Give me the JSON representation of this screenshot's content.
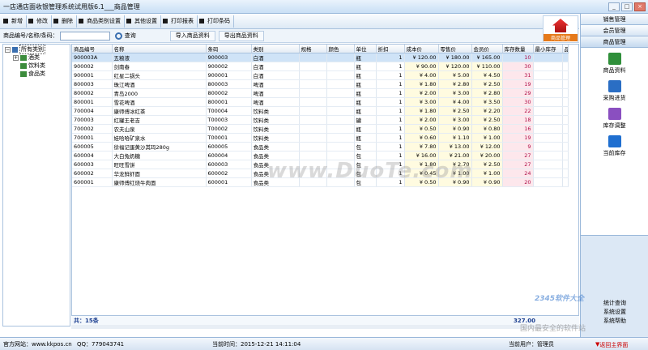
{
  "window": {
    "title": "一店通店面收银管理系统试用版6.1___商品管理",
    "min": "_",
    "max": "□",
    "close": "×"
  },
  "toolbar": {
    "items": [
      "新增",
      "修改",
      "删除",
      "商品类别设置",
      "其他设置",
      "打印报表",
      "打印条码"
    ]
  },
  "search": {
    "label": "商品编号/名称/条码：",
    "value": "",
    "query_btn": "查询",
    "import_btn": "导入商品资料",
    "export_btn": "导出商品资料"
  },
  "tree": {
    "root": "所有类别",
    "nodes": [
      "酒类",
      "饮料类",
      "食品类"
    ],
    "expand": "+"
  },
  "table": {
    "headers": [
      "商品编号",
      "名称",
      "条码",
      "类别",
      "规格",
      "颜色",
      "单位",
      "折扣",
      "成本价",
      "零售价",
      "会员价",
      "库存数量",
      "最小库存",
      "品牌"
    ],
    "rows": [
      [
        "900003A",
        "五粮液",
        "900003",
        "白酒",
        "",
        "",
        "瓶",
        "1",
        "¥ 120.00",
        "¥ 180.00",
        "¥ 165.00",
        "10",
        "",
        ""
      ],
      [
        "900002",
        "剑南春",
        "900002",
        "白酒",
        "",
        "",
        "瓶",
        "1",
        "¥ 90.00",
        "¥ 120.00",
        "¥ 110.00",
        "30",
        "",
        ""
      ],
      [
        "900001",
        "红星二锅头",
        "900001",
        "白酒",
        "",
        "",
        "瓶",
        "1",
        "¥ 4.00",
        "¥ 5.00",
        "¥ 4.50",
        "31",
        "",
        ""
      ],
      [
        "800003",
        "珠江啤酒",
        "800003",
        "啤酒",
        "",
        "",
        "瓶",
        "1",
        "¥ 1.80",
        "¥ 2.80",
        "¥ 2.50",
        "19",
        "",
        ""
      ],
      [
        "800002",
        "青岛2000",
        "800002",
        "啤酒",
        "",
        "",
        "瓶",
        "1",
        "¥ 2.00",
        "¥ 3.00",
        "¥ 2.80",
        "29",
        "",
        ""
      ],
      [
        "800001",
        "雪花啤酒",
        "800001",
        "啤酒",
        "",
        "",
        "瓶",
        "1",
        "¥ 3.00",
        "¥ 4.00",
        "¥ 3.50",
        "30",
        "",
        ""
      ],
      [
        "700004",
        "康师傅冰红茶",
        "T00004",
        "饮料类",
        "",
        "",
        "瓶",
        "1",
        "¥ 1.80",
        "¥ 2.50",
        "¥ 2.20",
        "22",
        "",
        ""
      ],
      [
        "700003",
        "红罐王老吉",
        "T00003",
        "饮料类",
        "",
        "",
        "罐",
        "1",
        "¥ 2.00",
        "¥ 3.00",
        "¥ 2.50",
        "18",
        "",
        ""
      ],
      [
        "700002",
        "农夫山泉",
        "T00002",
        "饮料类",
        "",
        "",
        "瓶",
        "1",
        "¥ 0.50",
        "¥ 0.90",
        "¥ 0.80",
        "16",
        "",
        ""
      ],
      [
        "700001",
        "娃哈哈矿泉水",
        "T00001",
        "饮料类",
        "",
        "",
        "瓶",
        "1",
        "¥ 0.60",
        "¥ 1.10",
        "¥ 1.00",
        "19",
        "",
        ""
      ],
      [
        "600005",
        "徐福记蛋黄沙其玛280g",
        "600005",
        "食品类",
        "",
        "",
        "包",
        "1",
        "¥ 7.80",
        "¥ 13.00",
        "¥ 12.00",
        "9",
        "",
        ""
      ],
      [
        "600004",
        "大白兔奶糖",
        "600004",
        "食品类",
        "",
        "",
        "包",
        "1",
        "¥ 16.00",
        "¥ 21.00",
        "¥ 20.00",
        "27",
        "",
        ""
      ],
      [
        "600003",
        "旺旺雪饼",
        "600003",
        "食品类",
        "",
        "",
        "包",
        "1",
        "¥ 1.80",
        "¥ 2.70",
        "¥ 2.50",
        "27",
        "",
        ""
      ],
      [
        "600002",
        "华龙鲜虾面",
        "600002",
        "食品类",
        "",
        "",
        "包",
        "1",
        "¥ 0.45",
        "¥ 1.00",
        "¥ 1.00",
        "24",
        "",
        ""
      ],
      [
        "600001",
        "康师傅红烧牛肉面",
        "600001",
        "食品类",
        "",
        "",
        "包",
        "1",
        "¥ 0.50",
        "¥ 0.90",
        "¥ 0.90",
        "20",
        "",
        ""
      ]
    ],
    "footer_count": "共：15条",
    "footer_total": "327.00"
  },
  "sidebar": {
    "headers": [
      "销售管理",
      "会员管理",
      "商品管理"
    ],
    "logo_text": "商品管理",
    "items": [
      {
        "label": "商品资料",
        "color": "#2f8f3a"
      },
      {
        "label": "采购进货",
        "color": "#2a6ec4"
      },
      {
        "label": "库存调整",
        "color": "#8a4fc0"
      },
      {
        "label": "当前库存",
        "color": "#1f6fd0"
      }
    ],
    "bottom": [
      "统计查询",
      "系统设置",
      "系统帮助"
    ]
  },
  "status": {
    "website": "官方网站：www.kkpos.cn",
    "qq": "QQ：779043741",
    "time": "当前时间：2015-12-21 14:11:04",
    "user": "当前用户：管理员",
    "back": "返回主界面"
  },
  "watermarks": [
    "www.DuoTe.com",
    "国内最安全的软件站",
    "2345软件大全"
  ]
}
